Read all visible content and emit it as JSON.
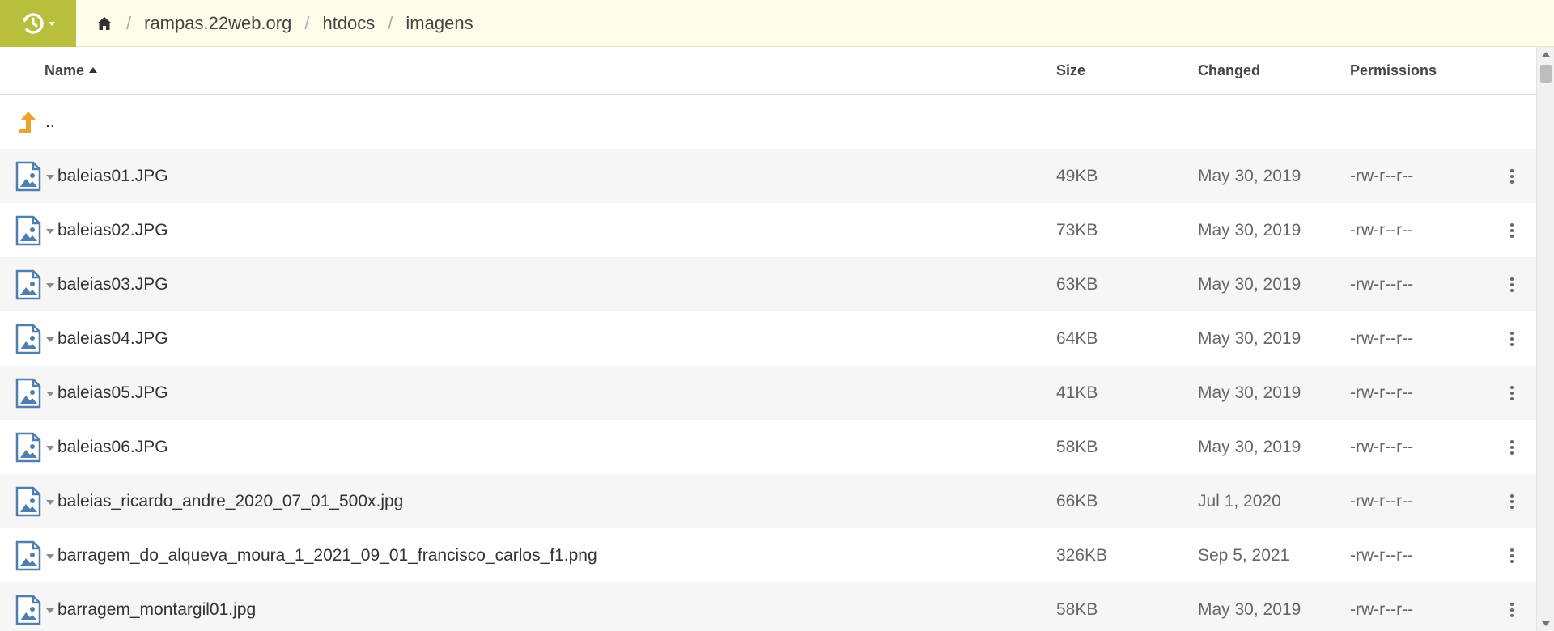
{
  "theme": {
    "accent": "#b8bf3c",
    "header_bg": "#fefde9",
    "file_icon": "#4f7fae",
    "up_icon": "#f0a030"
  },
  "breadcrumb": {
    "home_icon": "home-icon",
    "items": [
      "rampas.22web.org",
      "htdocs",
      "imagens"
    ],
    "separator": "/"
  },
  "columns": {
    "name": "Name",
    "size": "Size",
    "changed": "Changed",
    "permissions": "Permissions"
  },
  "parent": {
    "label": ".."
  },
  "files": [
    {
      "name": "baleias01.JPG",
      "size": "49KB",
      "changed": "May 30, 2019",
      "permissions": "-rw-r--r--"
    },
    {
      "name": "baleias02.JPG",
      "size": "73KB",
      "changed": "May 30, 2019",
      "permissions": "-rw-r--r--"
    },
    {
      "name": "baleias03.JPG",
      "size": "63KB",
      "changed": "May 30, 2019",
      "permissions": "-rw-r--r--"
    },
    {
      "name": "baleias04.JPG",
      "size": "64KB",
      "changed": "May 30, 2019",
      "permissions": "-rw-r--r--"
    },
    {
      "name": "baleias05.JPG",
      "size": "41KB",
      "changed": "May 30, 2019",
      "permissions": "-rw-r--r--"
    },
    {
      "name": "baleias06.JPG",
      "size": "58KB",
      "changed": "May 30, 2019",
      "permissions": "-rw-r--r--"
    },
    {
      "name": "baleias_ricardo_andre_2020_07_01_500x.jpg",
      "size": "66KB",
      "changed": "Jul 1, 2020",
      "permissions": "-rw-r--r--"
    },
    {
      "name": "barragem_do_alqueva_moura_1_2021_09_01_francisco_carlos_f1.png",
      "size": "326KB",
      "changed": "Sep 5, 2021",
      "permissions": "-rw-r--r--"
    },
    {
      "name": "barragem_montargil01.jpg",
      "size": "58KB",
      "changed": "May 30, 2019",
      "permissions": "-rw-r--r--"
    }
  ]
}
